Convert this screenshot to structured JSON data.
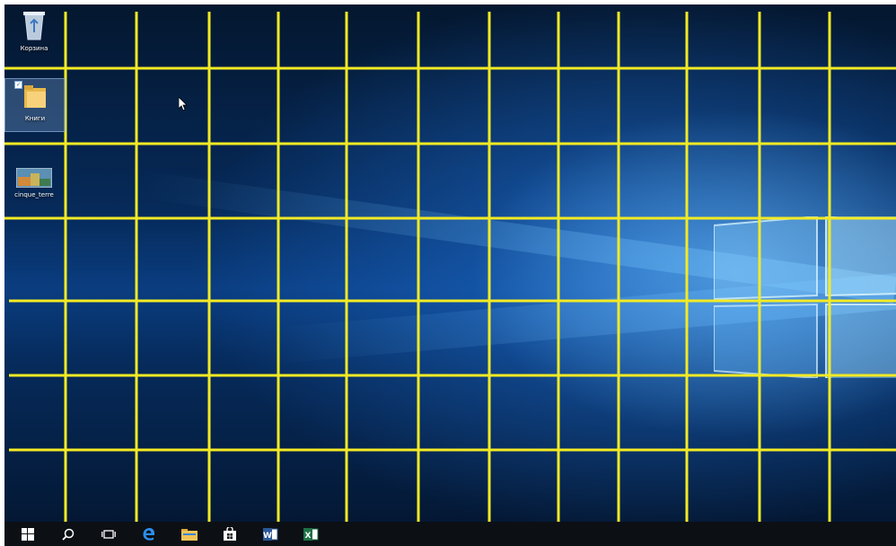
{
  "desktop": {
    "icons": [
      {
        "label": "Корзина",
        "icon": "recycle-bin-icon"
      },
      {
        "label": "Книги",
        "icon": "folder-icon",
        "selected": true
      },
      {
        "label": "cinque_terre",
        "icon": "image-file-icon"
      }
    ],
    "wallpaper": "windows-10-hero",
    "grid_color": "#f3ea24"
  },
  "taskbar": {
    "items": [
      {
        "name": "start-button",
        "icon": "windows-logo-icon"
      },
      {
        "name": "search-button",
        "icon": "search-icon"
      },
      {
        "name": "task-view-button",
        "icon": "task-view-icon"
      },
      {
        "name": "edge-button",
        "icon": "edge-icon"
      },
      {
        "name": "file-explorer-button",
        "icon": "folder-icon"
      },
      {
        "name": "store-button",
        "icon": "store-icon"
      },
      {
        "name": "word-button",
        "icon": "word-icon",
        "letter": "W"
      },
      {
        "name": "excel-button",
        "icon": "excel-icon",
        "letter": "X"
      }
    ]
  }
}
